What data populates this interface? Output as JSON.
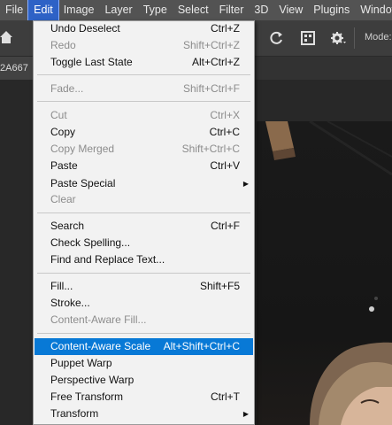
{
  "menubar": {
    "items": [
      "File",
      "Edit",
      "Image",
      "Layer",
      "Type",
      "Select",
      "Filter",
      "3D",
      "View",
      "Plugins",
      "Window"
    ],
    "active_index": 1
  },
  "options_bar": {
    "mode_label": "Mode:",
    "icons": [
      "home-icon",
      "rotate-icon",
      "crop-grid-icon",
      "gear-icon"
    ]
  },
  "tab": {
    "title": "2A667"
  },
  "edit_menu": {
    "groups": [
      [
        {
          "label": "Undo Deselect",
          "shortcut": "Ctrl+Z",
          "enabled": true
        },
        {
          "label": "Redo",
          "shortcut": "Shift+Ctrl+Z",
          "enabled": false
        },
        {
          "label": "Toggle Last State",
          "shortcut": "Alt+Ctrl+Z",
          "enabled": true
        }
      ],
      [
        {
          "label": "Fade...",
          "shortcut": "Shift+Ctrl+F",
          "enabled": false
        }
      ],
      [
        {
          "label": "Cut",
          "shortcut": "Ctrl+X",
          "enabled": false
        },
        {
          "label": "Copy",
          "shortcut": "Ctrl+C",
          "enabled": true
        },
        {
          "label": "Copy Merged",
          "shortcut": "Shift+Ctrl+C",
          "enabled": false
        },
        {
          "label": "Paste",
          "shortcut": "Ctrl+V",
          "enabled": true
        },
        {
          "label": "Paste Special",
          "shortcut": "",
          "enabled": true,
          "submenu": true
        },
        {
          "label": "Clear",
          "shortcut": "",
          "enabled": false
        }
      ],
      [
        {
          "label": "Search",
          "shortcut": "Ctrl+F",
          "enabled": true
        },
        {
          "label": "Check Spelling...",
          "shortcut": "",
          "enabled": true
        },
        {
          "label": "Find and Replace Text...",
          "shortcut": "",
          "enabled": true
        }
      ],
      [
        {
          "label": "Fill...",
          "shortcut": "Shift+F5",
          "enabled": true
        },
        {
          "label": "Stroke...",
          "shortcut": "",
          "enabled": true
        },
        {
          "label": "Content-Aware Fill...",
          "shortcut": "",
          "enabled": false
        }
      ],
      [
        {
          "label": "Content-Aware Scale",
          "shortcut": "Alt+Shift+Ctrl+C",
          "enabled": true,
          "highlighted": true
        },
        {
          "label": "Puppet Warp",
          "shortcut": "",
          "enabled": true
        },
        {
          "label": "Perspective Warp",
          "shortcut": "",
          "enabled": true
        },
        {
          "label": "Free Transform",
          "shortcut": "Ctrl+T",
          "enabled": true
        },
        {
          "label": "Transform",
          "shortcut": "",
          "enabled": true,
          "submenu": true
        }
      ]
    ]
  },
  "colors": {
    "menubar_bg": "#535353",
    "menu_bg": "#f2f2f2",
    "highlight": "#0879d6",
    "disabled_text": "#8c8c8c"
  }
}
